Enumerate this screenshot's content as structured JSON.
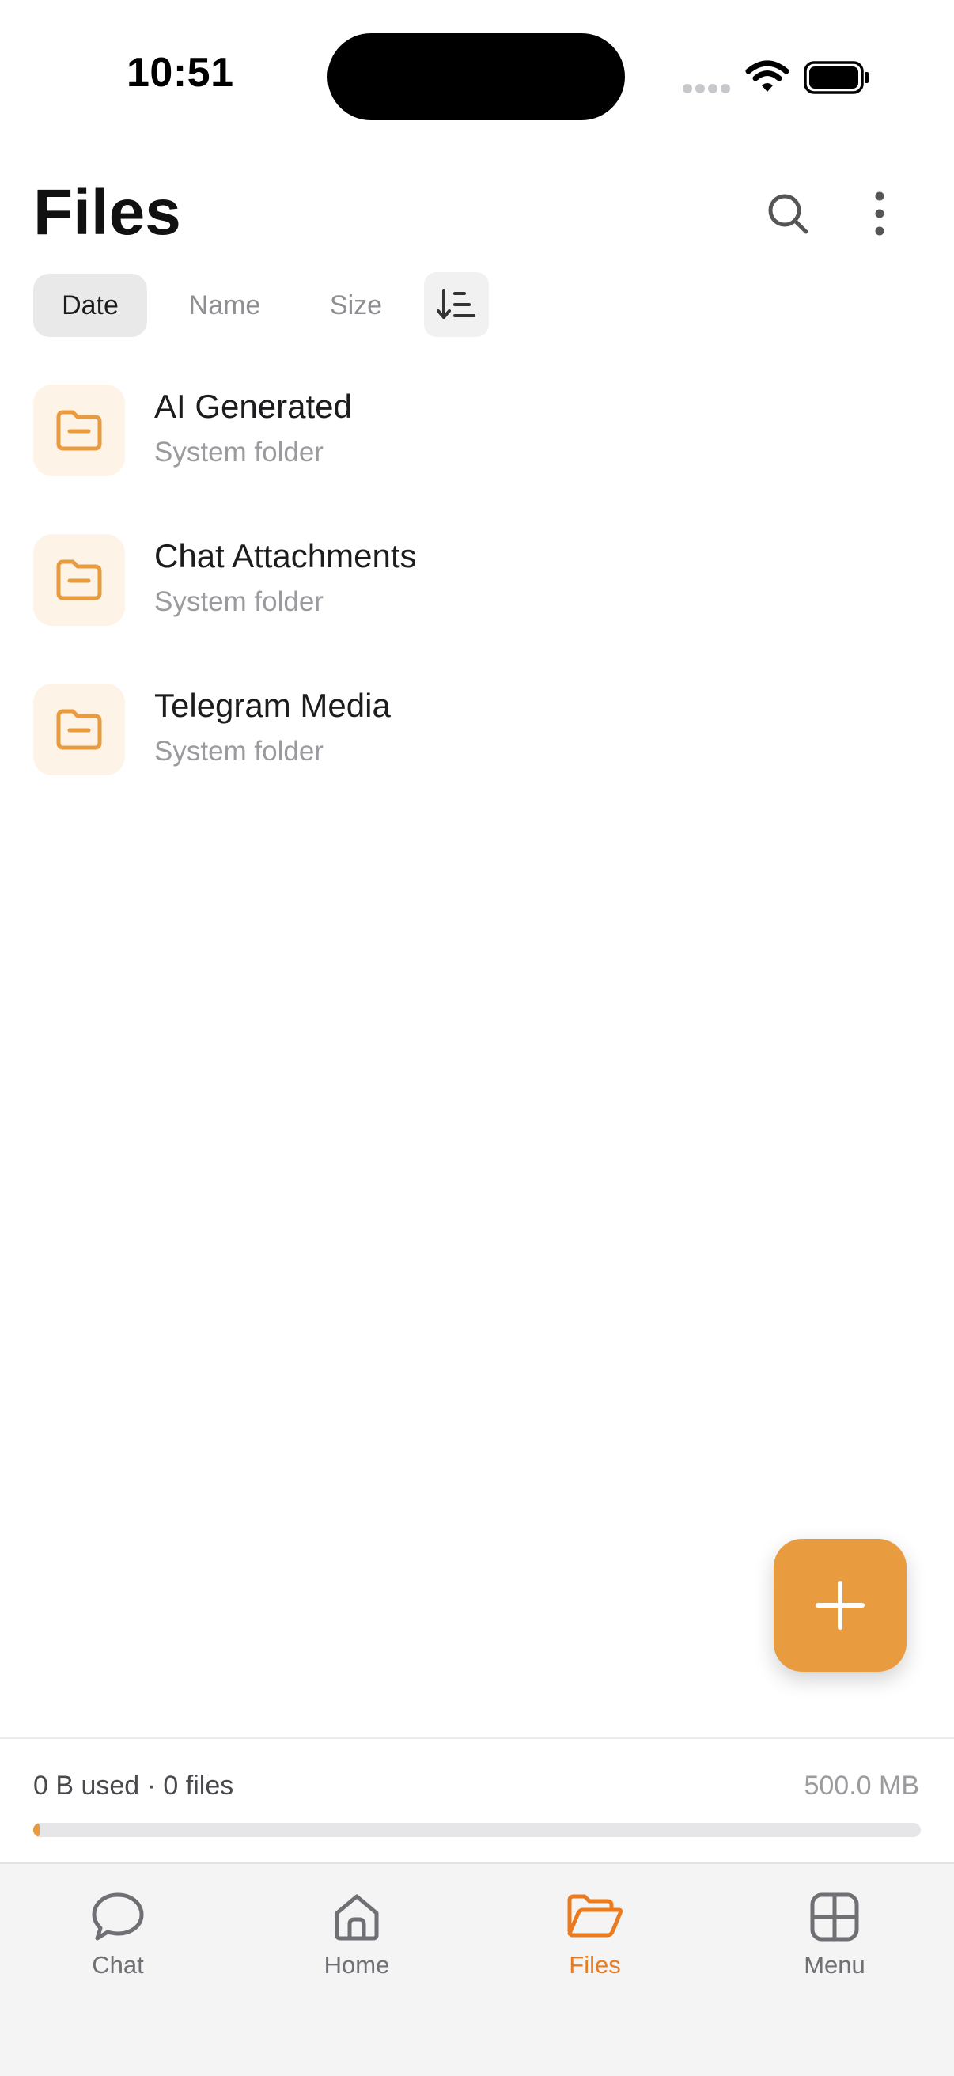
{
  "status_bar": {
    "time": "10:51"
  },
  "header": {
    "title": "Files"
  },
  "sort": {
    "options": [
      {
        "label": "Date",
        "active": true
      },
      {
        "label": "Name",
        "active": false
      },
      {
        "label": "Size",
        "active": false
      }
    ]
  },
  "folders": [
    {
      "name": "AI Generated",
      "subtitle": "System folder"
    },
    {
      "name": "Chat Attachments",
      "subtitle": "System folder"
    },
    {
      "name": "Telegram Media",
      "subtitle": "System folder"
    }
  ],
  "storage": {
    "used_text": "0 B used · 0 files",
    "capacity_text": "500.0 MB",
    "used_fraction": 0
  },
  "tabs": [
    {
      "label": "Chat",
      "icon": "chat-bubble-icon",
      "active": false
    },
    {
      "label": "Home",
      "icon": "home-icon",
      "active": false
    },
    {
      "label": "Files",
      "icon": "folder-open-icon",
      "active": true
    },
    {
      "label": "Menu",
      "icon": "grid-icon",
      "active": false
    }
  ],
  "colors": {
    "accent": "#e89b3f",
    "active_tab": "#ea7b1f",
    "folder_tile": "#fdf3e7"
  }
}
